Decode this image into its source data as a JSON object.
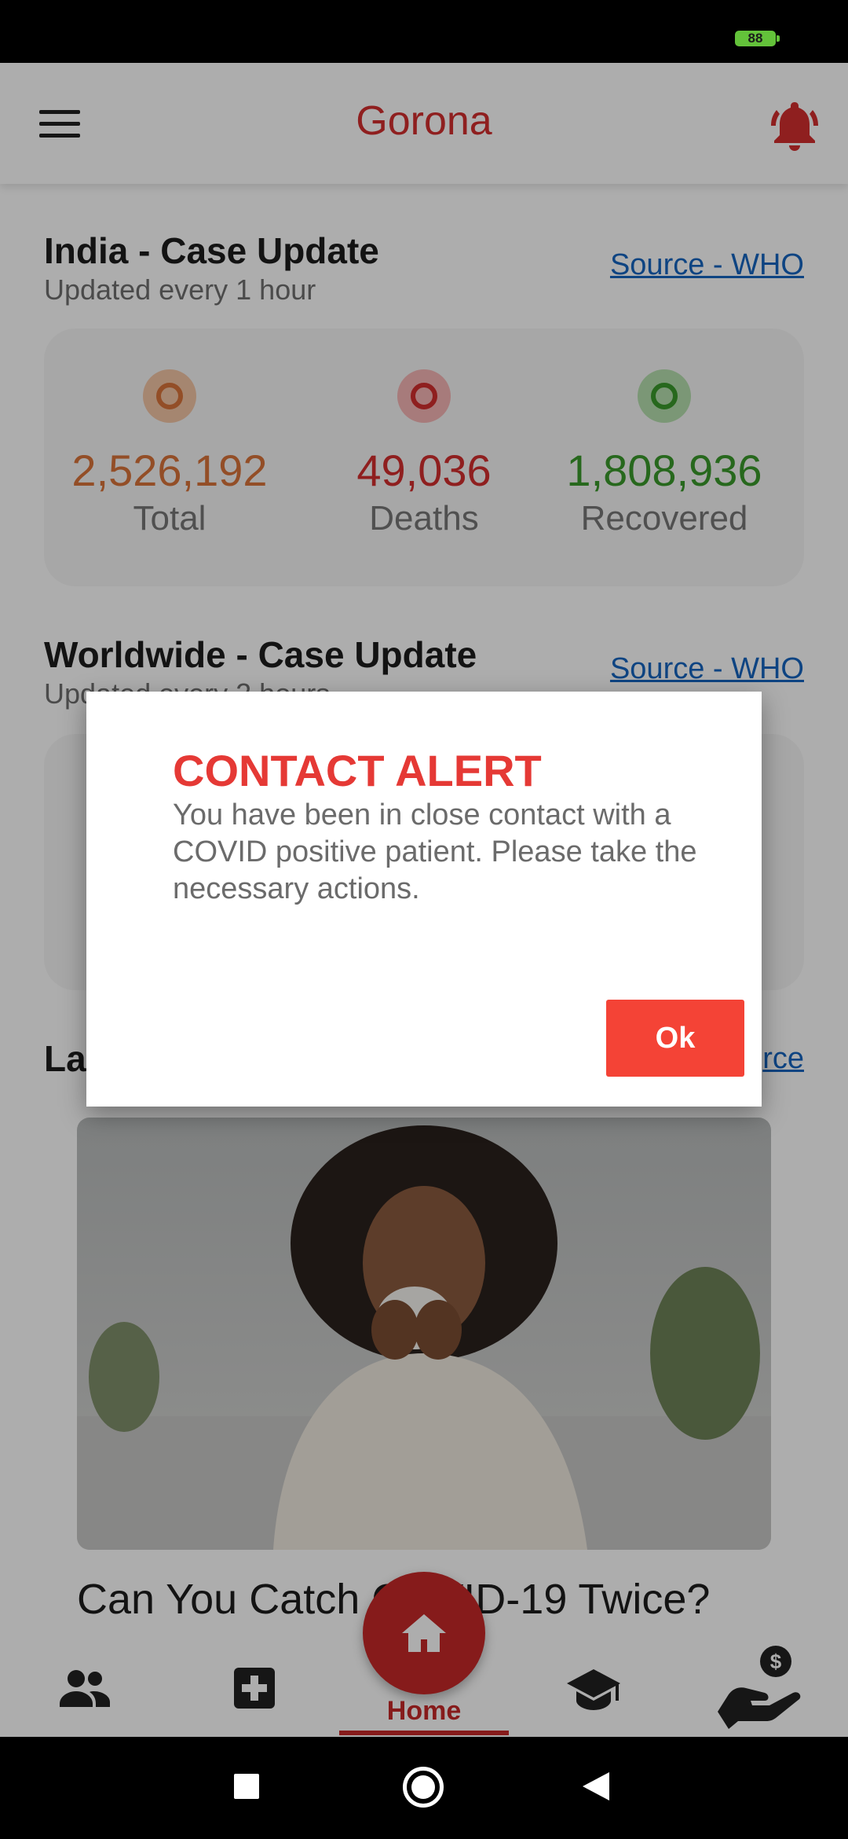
{
  "status_bar": {
    "battery": "88"
  },
  "app_bar": {
    "title": "Gorona"
  },
  "india": {
    "title": "India - Case Update",
    "subtitle": "Updated every 1 hour",
    "source": "Source - WHO",
    "stats": [
      {
        "value": "2,526,192",
        "label": "Total",
        "color": "#d9743a",
        "ring": "#f4c6a6"
      },
      {
        "value": "49,036",
        "label": "Deaths",
        "color": "#d32f2f",
        "ring": "#f6b5b5"
      },
      {
        "value": "1,808,936",
        "label": "Recovered",
        "color": "#3a9a2c",
        "ring": "#b6dfae"
      }
    ]
  },
  "worldwide": {
    "title": "Worldwide - Case Update",
    "subtitle": "Updated every 2 hours",
    "source": "Source - WHO"
  },
  "latest": {
    "title_fragment": "La",
    "source_fragment": "rce"
  },
  "news": {
    "title": "Can You Catch COVID-19 Twice?"
  },
  "bottom_nav": {
    "items": [
      "people-icon",
      "medical-cross-icon",
      "home-icon",
      "graduation-cap-icon",
      "donate-hand-icon"
    ],
    "home_label": "Home"
  },
  "dialog": {
    "title": "CONTACT ALERT",
    "message": "You have been in close contact with a COVID positive patient. Please take the necessary actions.",
    "ok_label": "Ok"
  },
  "colors": {
    "brand": "#d32f2f",
    "accent_button": "#f44336",
    "link": "#1565c0"
  }
}
